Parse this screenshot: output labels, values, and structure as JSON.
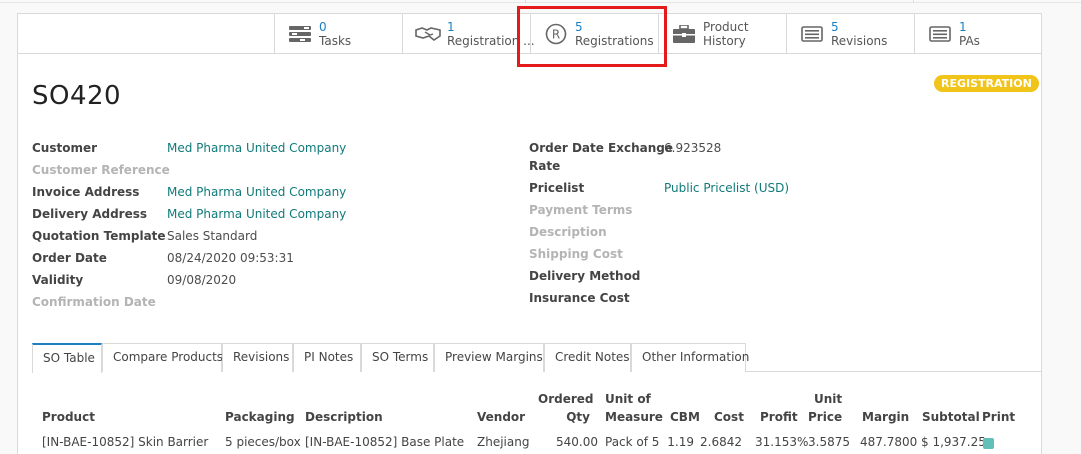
{
  "smart_buttons": [
    {
      "count": "0",
      "label": "Tasks",
      "icon": "tasks-icon"
    },
    {
      "count": "1",
      "label": "Registration ...",
      "icon": "handshake-icon"
    },
    {
      "count": "5",
      "label": "Registrations",
      "icon": "registered-icon"
    },
    {
      "count": "",
      "label": "Product",
      "label2": "History",
      "icon": "briefcase-icon"
    },
    {
      "count": "5",
      "label": "Revisions",
      "icon": "list-icon"
    },
    {
      "count": "1",
      "label": "PAs",
      "icon": "list-icon"
    }
  ],
  "record": {
    "name": "SO420",
    "status": "REGISTRATION"
  },
  "left_fields": {
    "customer": {
      "label": "Customer",
      "value": "Med Pharma United Company"
    },
    "customer_reference": {
      "label": "Customer Reference",
      "value": ""
    },
    "invoice_address": {
      "label": "Invoice Address",
      "value": "Med Pharma United Company"
    },
    "delivery_address": {
      "label": "Delivery Address",
      "value": "Med Pharma United Company"
    },
    "quotation_template": {
      "label": "Quotation Template",
      "value": "Sales Standard"
    },
    "order_date": {
      "label": "Order Date",
      "value": "08/24/2020 09:53:31"
    },
    "validity": {
      "label": "Validity",
      "value": "09/08/2020"
    },
    "confirmation_date": {
      "label": "Confirmation Date",
      "value": ""
    }
  },
  "right_fields": {
    "exchange_rate": {
      "label": "Order Date Exchange",
      "label2": "Rate",
      "value": "6.923528"
    },
    "pricelist": {
      "label": "Pricelist",
      "value": "Public Pricelist (USD)"
    },
    "payment_terms": {
      "label": "Payment Terms"
    },
    "description": {
      "label": "Description"
    },
    "shipping_cost": {
      "label": "Shipping Cost"
    },
    "delivery_method": {
      "label": "Delivery Method"
    },
    "insurance_cost": {
      "label": "Insurance Cost"
    }
  },
  "tabs": [
    "SO Table",
    "Compare Products",
    "Revisions",
    "PI Notes",
    "SO Terms",
    "Preview Margins",
    "Credit Notes",
    "Other Information"
  ],
  "table": {
    "headers": {
      "product": "Product",
      "packaging": "Packaging",
      "description": "Description",
      "vendor": "Vendor",
      "ordered_qty_1": "Ordered",
      "ordered_qty_2": "Qty",
      "uom_1": "Unit of",
      "uom_2": "Measure",
      "cbm": "CBM",
      "cost": "Cost",
      "profit": "Profit",
      "unit_price_1": "Unit",
      "unit_price_2": "Price",
      "margin": "Margin",
      "subtotal": "Subtotal",
      "print": "Print"
    },
    "rows": [
      {
        "product": "[IN-BAE-10852] Skin Barrier",
        "packaging": "5 pieces/box",
        "description": "[IN-BAE-10852] Base Plate",
        "vendor": "Zhejiang",
        "ordered_qty": "540.00",
        "uom": "Pack of 5",
        "cbm": "1.19",
        "cost": "2.6842",
        "profit": "31.153%",
        "unit_price": "3.5875",
        "margin": "487.7800",
        "subtotal": "$ 1,937.25",
        "print": true
      }
    ]
  },
  "colors": {
    "link": "#117a7a",
    "count": "#1e7fc0",
    "badge": "#f0c419",
    "highlight": "#e31b1b",
    "checkbox": "#62c0b8"
  }
}
